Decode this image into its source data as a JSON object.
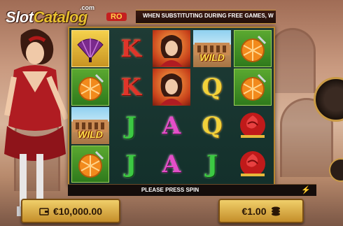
{
  "header": {
    "logo_main": "SlotCatalog",
    "logo_suffix": "RO",
    "logo_dotcom": ".com",
    "marquee_text": "WHEN SUBSTITUTING DURING FREE GAMES, W"
  },
  "reels": [
    {
      "symbols": [
        "fan",
        "orange",
        "wild",
        "orange"
      ]
    },
    {
      "symbols": [
        "K",
        "K",
        "J",
        "J"
      ]
    },
    {
      "symbols": [
        "flamenco-woman",
        "flamenco-woman",
        "A",
        "A"
      ]
    },
    {
      "symbols": [
        "wild",
        "Q",
        "Q",
        "J"
      ]
    },
    {
      "symbols": [
        "orange",
        "orange",
        "rose",
        "rose"
      ]
    }
  ],
  "symbols": {
    "wild_label": "WILD",
    "K": "K",
    "Q": "Q",
    "J": "J",
    "A": "A"
  },
  "message": {
    "text": "PLEASE PRESS SPIN"
  },
  "balance": {
    "value": "€10,000.00",
    "icon": "wallet-icon"
  },
  "bet": {
    "value": "€1.00",
    "icon": "coins-icon"
  },
  "colors": {
    "reel_bg": "#13302b",
    "frame_gold": "#b8862f",
    "panel_gold": "#f0cf6a"
  }
}
